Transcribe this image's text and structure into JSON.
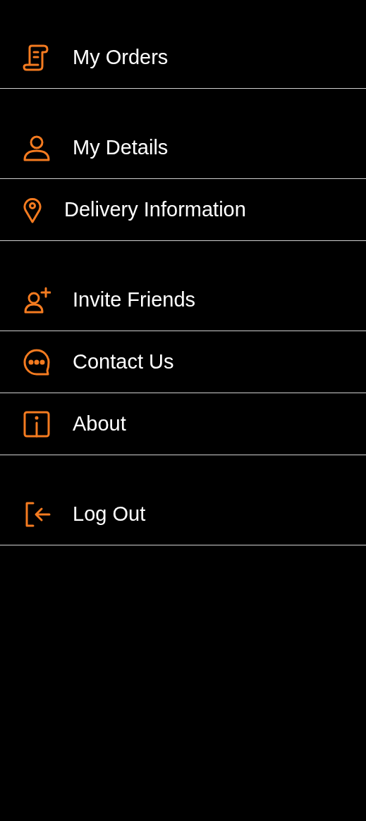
{
  "menu": {
    "sections": [
      {
        "items": [
          {
            "label": "My Orders"
          }
        ]
      },
      {
        "items": [
          {
            "label": "My Details"
          },
          {
            "label": "Delivery Information"
          }
        ]
      },
      {
        "items": [
          {
            "label": "Invite Friends"
          },
          {
            "label": "Contact Us"
          },
          {
            "label": "About"
          }
        ]
      },
      {
        "items": [
          {
            "label": "Log Out"
          }
        ]
      }
    ]
  }
}
